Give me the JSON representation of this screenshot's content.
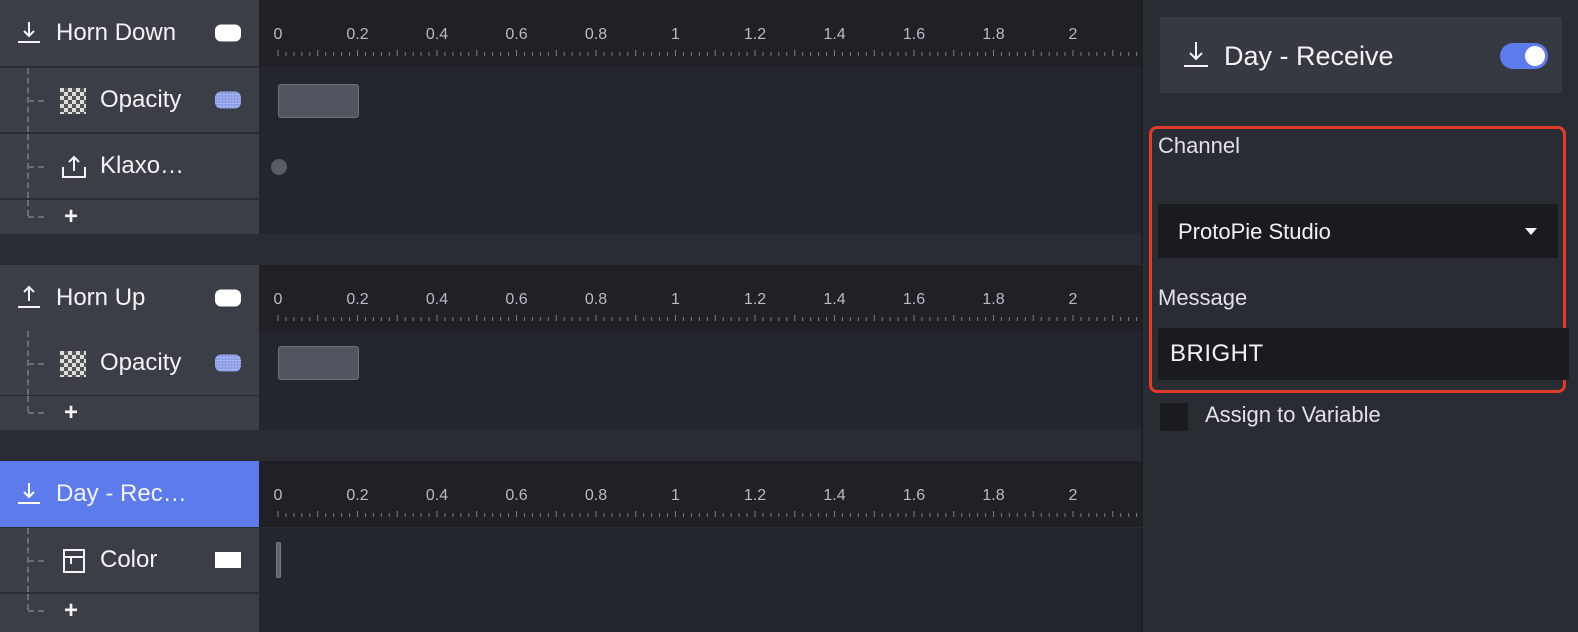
{
  "triggers": [
    {
      "label": "Horn Down",
      "icon": "receive-arrow-down-icon",
      "selected": false,
      "responses": [
        {
          "label": "Opacity",
          "icon": "checker-icon",
          "pill": "dotted"
        },
        {
          "label": "Klaxo…",
          "icon": "send-arrow-up-icon",
          "pill": "none"
        }
      ],
      "add_label": "+"
    },
    {
      "label": "Horn Up",
      "icon": "send-arrow-up-icon",
      "selected": false,
      "responses": [
        {
          "label": "Opacity",
          "icon": "checker-icon",
          "pill": "dotted"
        }
      ],
      "add_label": "+"
    },
    {
      "label": "Day - Rec…",
      "icon": "receive-arrow-down-icon",
      "selected": true,
      "responses": [
        {
          "label": "Color",
          "icon": "color-box-icon",
          "pill": "rect"
        }
      ],
      "add_label": "+"
    }
  ],
  "ruler_ticks": [
    "0",
    "0.2",
    "0.4",
    "0.6",
    "0.8",
    "1",
    "1.2",
    "1.4",
    "1.6",
    "1.8",
    "2"
  ],
  "inspector": {
    "title": "Day - Receive",
    "icon": "receive-arrow-down-icon",
    "enabled": true,
    "channel_label": "Channel",
    "channel_value": "ProtoPie Studio",
    "message_label": "Message",
    "message_value": "BRIGHT",
    "assign_label": "Assign to Variable",
    "assign_checked": false
  },
  "colors": {
    "accent": "#5d7bea",
    "highlight": "#e03c2e",
    "panel_bg": "#2a2c34",
    "row_bg": "#3b3e47",
    "timeline_bg": "#24262d"
  }
}
